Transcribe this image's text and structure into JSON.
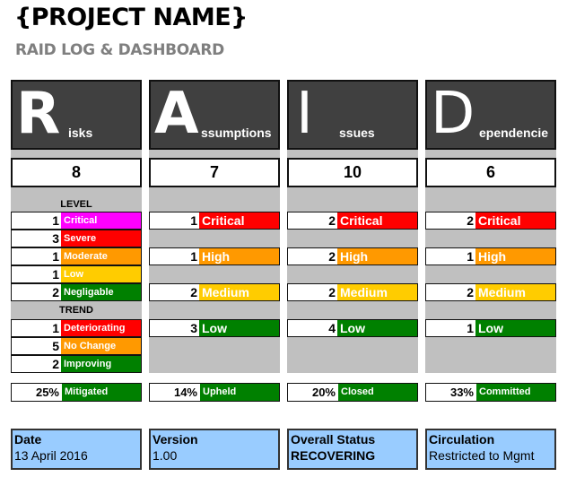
{
  "header": {
    "title": "{PROJECT NAME}",
    "subtitle": "RAID LOG & DASHBOARD"
  },
  "colors": {
    "magenta": "#ff00ff",
    "red": "#ff0000",
    "orange": "#ff9900",
    "yellow": "#ffcc00",
    "green": "#008000",
    "header_bg": "#404040",
    "panel_grey": "#c0c0c0",
    "info_blue": "#99ccff"
  },
  "columns": [
    {
      "letter": "R",
      "rest": "isks",
      "count": "8",
      "level_label": "LEVEL",
      "levels": [
        {
          "count": "1",
          "label": "Critical",
          "color": "#ff00ff"
        },
        {
          "count": "3",
          "label": "Severe",
          "color": "#ff0000"
        },
        {
          "count": "1",
          "label": "Moderate",
          "color": "#ff9900"
        },
        {
          "count": "1",
          "label": "Low",
          "color": "#ffcc00"
        },
        {
          "count": "2",
          "label": "Negligable",
          "color": "#008000"
        }
      ],
      "trend_label": "TREND",
      "trends": [
        {
          "count": "1",
          "label": "Deteriorating",
          "color": "#ff0000"
        },
        {
          "count": "5",
          "label": "No Change",
          "color": "#ff9900"
        },
        {
          "count": "2",
          "label": "Improving",
          "color": "#008000"
        }
      ],
      "pct": "25%",
      "pct_label": "Mitigated"
    },
    {
      "letter": "A",
      "rest": "ssumptions",
      "count": "7",
      "levels": [
        {
          "count": "1",
          "label": "Critical",
          "color": "#ff0000"
        },
        {
          "count": "1",
          "label": "High",
          "color": "#ff9900"
        },
        {
          "count": "2",
          "label": "Medium",
          "color": "#ffcc00"
        },
        {
          "count": "3",
          "label": "Low",
          "color": "#008000"
        }
      ],
      "pct": "14%",
      "pct_label": "Upheld"
    },
    {
      "letter": "I",
      "rest": "ssues",
      "count": "10",
      "levels": [
        {
          "count": "2",
          "label": "Critical",
          "color": "#ff0000"
        },
        {
          "count": "2",
          "label": "High",
          "color": "#ff9900"
        },
        {
          "count": "2",
          "label": "Medium",
          "color": "#ffcc00"
        },
        {
          "count": "4",
          "label": "Low",
          "color": "#008000"
        }
      ],
      "pct": "20%",
      "pct_label": "Closed"
    },
    {
      "letter": "D",
      "rest": "ependencie",
      "count": "6",
      "levels": [
        {
          "count": "2",
          "label": "Critical",
          "color": "#ff0000"
        },
        {
          "count": "1",
          "label": "High",
          "color": "#ff9900"
        },
        {
          "count": "2",
          "label": "Medium",
          "color": "#ffcc00"
        },
        {
          "count": "1",
          "label": "Low",
          "color": "#008000"
        }
      ],
      "pct": "33%",
      "pct_label": "Committed"
    }
  ],
  "info": [
    {
      "key": "Date",
      "value": "13 April 2016"
    },
    {
      "key": "Version",
      "value": "1.00"
    },
    {
      "key": "Overall Status",
      "value": "RECOVERING"
    },
    {
      "key": "Circulation",
      "value": "Restricted to Mgmt"
    }
  ]
}
